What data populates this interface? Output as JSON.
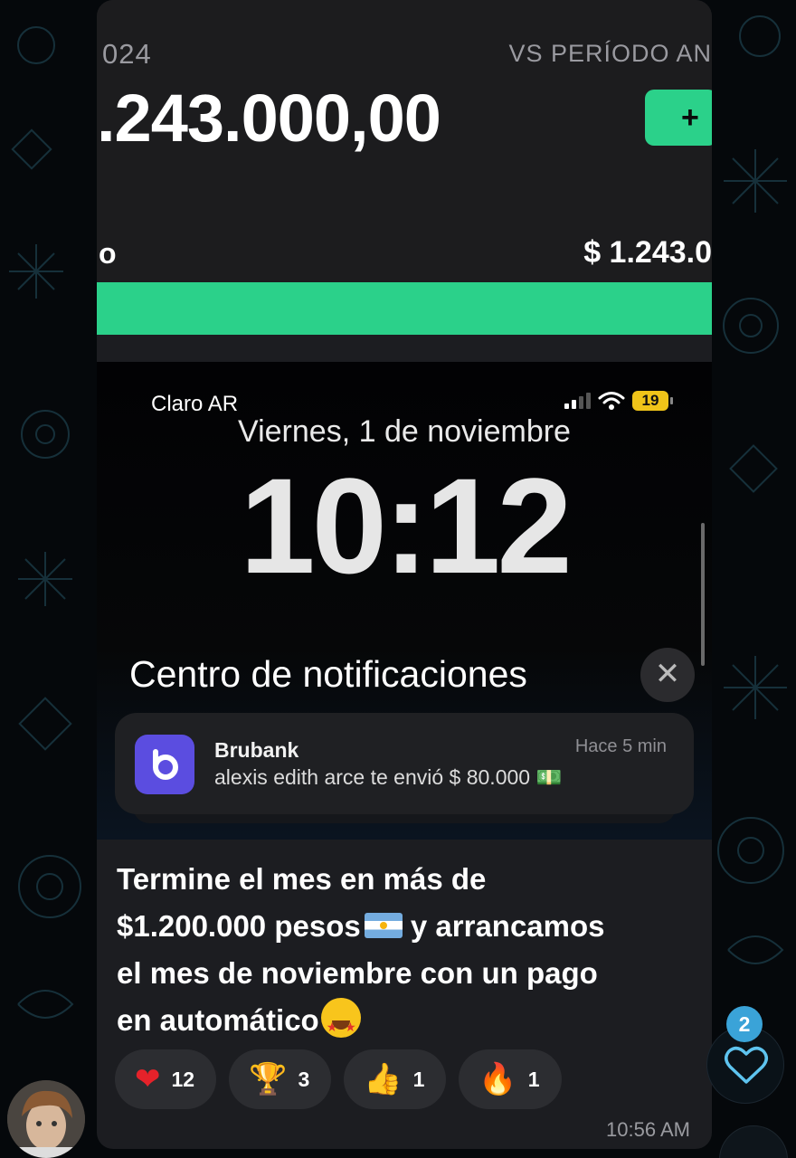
{
  "top_screenshot": {
    "year_fragment": "024",
    "comparison_label": "VS PERÍODO AN",
    "total_amount": ".243.000,00",
    "plus_label": "+",
    "left_label_fragment": "o",
    "right_amount": "$ 1.243.0",
    "accent_color": "#2bd18a"
  },
  "lock_screen": {
    "carrier": "Claro AR",
    "battery_level": "19",
    "date": "Viernes, 1 de noviembre",
    "time": "10:12",
    "notification_center_title": "Centro de notificaciones",
    "close_icon": "close-icon",
    "notification": {
      "app_name": "Brubank",
      "time_ago": "Hace 5 min",
      "body": "alexis edith arce te envió $ 80.000",
      "emoji": "💵"
    }
  },
  "message": {
    "line1": "Termine el mes en más de",
    "line2_a": "$1.200.000 pesos",
    "line2_b": " y arrancamos",
    "line3": "el mes de noviembre con un pago",
    "line4": "en automático",
    "timestamp": "10:56 AM"
  },
  "reactions": [
    {
      "icon": "❤",
      "name": "heart",
      "count": "12"
    },
    {
      "icon": "🏆",
      "name": "trophy",
      "count": "3"
    },
    {
      "icon": "👍",
      "name": "thumbs-up",
      "count": "1"
    },
    {
      "icon": "🔥",
      "name": "fire",
      "count": "1"
    }
  ],
  "favorite_badge": "2"
}
